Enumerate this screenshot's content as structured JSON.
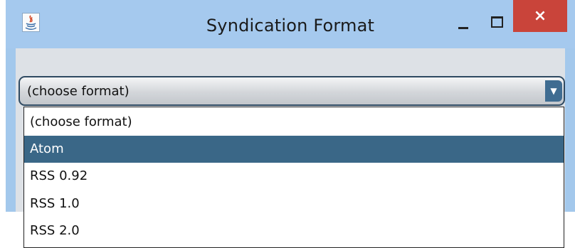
{
  "window": {
    "title": "Syndication Format",
    "controls": {
      "minimize": "minimize",
      "maximize": "maximize",
      "close": "×"
    },
    "app_icon": "java-icon"
  },
  "combo": {
    "selected_value": "(choose format)",
    "arrow_glyph": "▼",
    "options": [
      {
        "label": "(choose format)",
        "highlighted": false
      },
      {
        "label": "Atom",
        "highlighted": true
      },
      {
        "label": "RSS 0.92",
        "highlighted": false
      },
      {
        "label": "RSS 1.0",
        "highlighted": false
      },
      {
        "label": "RSS 2.0",
        "highlighted": false
      }
    ]
  },
  "colors": {
    "titlebar": "#a5c9ee",
    "close_button": "#c9443a",
    "highlight": "#3a6787"
  }
}
